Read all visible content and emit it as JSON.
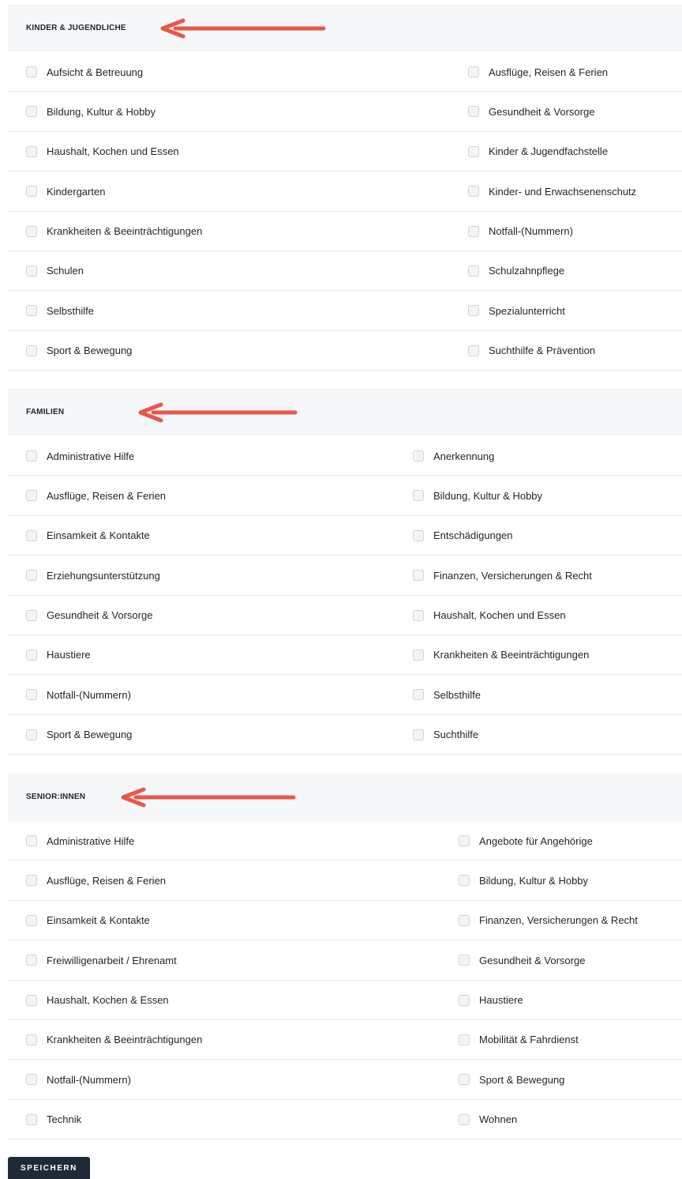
{
  "sections": [
    {
      "title": "KINDER & JUGENDLICHE",
      "items_left": [
        "Aufsicht & Betreuung",
        "Bildung, Kultur & Hobby",
        "Haushalt, Kochen und Essen",
        "Kindergarten",
        "Krankheiten & Beeinträchtigungen",
        "Schulen",
        "Selbsthilfe",
        "Sport & Bewegung"
      ],
      "items_right": [
        "Ausflüge, Reisen & Ferien",
        "Gesundheit & Vorsorge",
        "Kinder & Jugendfachstelle",
        "Kinder- und Erwachsenenschutz",
        "Notfall-(Nummern)",
        "Schulzahnpflege",
        "Spezialunterricht",
        "Suchthilfe & Prävention"
      ]
    },
    {
      "title": "FAMILIEN",
      "items_left": [
        "Administrative Hilfe",
        "Ausflüge, Reisen & Ferien",
        "Einsamkeit & Kontakte",
        "Erziehungsunterstützung",
        "Gesundheit & Vorsorge",
        "Haustiere",
        "Notfall-(Nummern)",
        "Sport & Bewegung"
      ],
      "items_right": [
        "Anerkennung",
        "Bildung, Kultur & Hobby",
        "Entschädigungen",
        "Finanzen, Versicherungen & Recht",
        "Haushalt, Kochen und Essen",
        "Krankheiten & Beeinträchtigungen",
        "Selbsthilfe",
        "Suchthilfe"
      ]
    },
    {
      "title": "SENIOR:INNEN",
      "items_left": [
        "Administrative Hilfe",
        "Ausflüge, Reisen & Ferien",
        "Einsamkeit & Kontakte",
        "Freiwilligenarbeit / Ehrenamt",
        "Haushalt, Kochen & Essen",
        "Krankheiten & Beeinträchtigungen",
        "Notfall-(Nummern)",
        "Technik"
      ],
      "items_right": [
        "Angebote für Angehörige",
        "Bildung, Kultur & Hobby",
        "Finanzen, Versicherungen & Recht",
        "Gesundheit & Vorsorge",
        "Haustiere",
        "Mobilität & Fahrdienst",
        "Sport & Bewegung",
        "Wohnen"
      ]
    }
  ],
  "save_label": "SPEICHERN",
  "colors": {
    "arrow": "#e8574b",
    "header_bg": "#f6f7f9",
    "button_bg": "#1f2a37"
  }
}
